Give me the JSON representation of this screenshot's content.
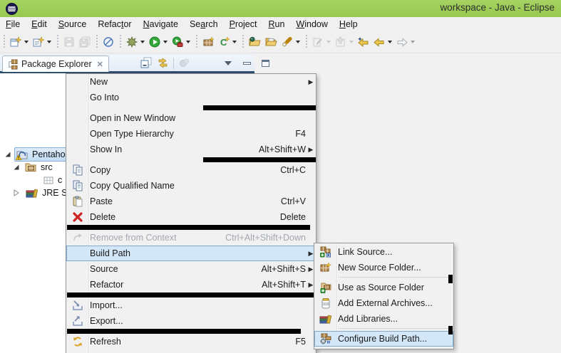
{
  "colors": {
    "titlebar_green": "#9ccd55",
    "keyline_navy": "#2f4d6e",
    "menu_highlight_bg": "#d3e7f9",
    "menu_highlight_border": "#7fabd4",
    "tree_selection_bg": "#c4def5",
    "redaction_black": "#000000"
  },
  "window": {
    "title": "workspace - Java - Eclipse",
    "logo": "eclipse-logo-icon"
  },
  "menubar": {
    "items": [
      {
        "label": "File",
        "mnemonic": 0
      },
      {
        "label": "Edit",
        "mnemonic": 0
      },
      {
        "label": "Source",
        "mnemonic": 0
      },
      {
        "label": "Refactor",
        "mnemonic": 5
      },
      {
        "label": "Navigate",
        "mnemonic": 0
      },
      {
        "label": "Search",
        "mnemonic": 2
      },
      {
        "label": "Project",
        "mnemonic": 0
      },
      {
        "label": "Run",
        "mnemonic": 0
      },
      {
        "label": "Window",
        "mnemonic": 0
      },
      {
        "label": "Help",
        "mnemonic": 0
      }
    ]
  },
  "toolbar": {
    "icons": [
      "new-wizard-icon",
      "new-java-wizard-icon",
      "save-icon",
      "save-all-icon",
      "skip-breakpoints-icon",
      "debug-icon",
      "run-icon",
      "external-tools-icon",
      "new-package-icon",
      "new-class-icon",
      "open-task-icon",
      "open-resource-icon",
      "mark-occurrences-icon",
      "next-annotation-icon",
      "previous-annotation-icon",
      "last-edit-location-icon",
      "back-icon",
      "forward-icon"
    ]
  },
  "package_explorer": {
    "tab_label": "Package Explorer",
    "view_buttons": [
      "collapse-all-icon",
      "link-with-editor-icon",
      "focus-task-icon",
      "view-menu-icon",
      "minimize-icon",
      "maximize-icon"
    ],
    "tree": [
      {
        "label": "Pentaho",
        "icon": "java-project-icon",
        "expanded": true,
        "selected": true
      },
      {
        "label": "src",
        "icon": "source-folder-icon",
        "expanded": true,
        "selected": false
      },
      {
        "label": "c",
        "icon": "package-icon",
        "selected": false
      },
      {
        "label": "JRE S",
        "icon": "library-icon",
        "expanded": false,
        "selected": false
      }
    ]
  },
  "context_menu": {
    "items": [
      {
        "label": "New",
        "arrow": true
      },
      {
        "label": "Go Into"
      },
      {
        "label": "Open in New Window"
      },
      {
        "label": "Open Type Hierarchy",
        "shortcut": "F4"
      },
      {
        "label": "Show In",
        "shortcut": "Alt+Shift+W",
        "arrow": true
      },
      {
        "label": "Copy",
        "shortcut": "Ctrl+C",
        "icon": "copy-icon"
      },
      {
        "label": "Copy Qualified Name",
        "icon": "copy-qualified-name-icon"
      },
      {
        "label": "Paste",
        "shortcut": "Ctrl+V",
        "icon": "paste-icon"
      },
      {
        "label": "Delete",
        "shortcut": "Delete",
        "icon": "delete-icon"
      },
      {
        "label": "Remove from Context",
        "shortcut": "Ctrl+Alt+Shift+Down",
        "icon": "remove-from-context-icon",
        "disabled": true
      },
      {
        "label": "Build Path",
        "arrow": true,
        "highlighted": true
      },
      {
        "label": "Source",
        "shortcut": "Alt+Shift+S",
        "arrow": true
      },
      {
        "label": "Refactor",
        "shortcut": "Alt+Shift+T",
        "arrow": true
      },
      {
        "label": "Import...",
        "icon": "import-icon"
      },
      {
        "label": "Export...",
        "icon": "export-icon"
      },
      {
        "label": "Refresh",
        "shortcut": "F5",
        "icon": "refresh-icon"
      }
    ]
  },
  "build_path_submenu": {
    "items": [
      {
        "label": "Link Source...",
        "icon": "link-source-icon"
      },
      {
        "label": "New Source Folder...",
        "icon": "new-source-folder-icon"
      },
      {
        "label": "Use as Source Folder",
        "icon": "use-as-source-folder-icon"
      },
      {
        "label": "Add External Archives...",
        "icon": "add-external-archives-icon"
      },
      {
        "label": "Add Libraries...",
        "icon": "add-libraries-icon"
      },
      {
        "label": "Configure Build Path...",
        "icon": "configure-build-path-icon",
        "highlighted": true
      }
    ]
  }
}
